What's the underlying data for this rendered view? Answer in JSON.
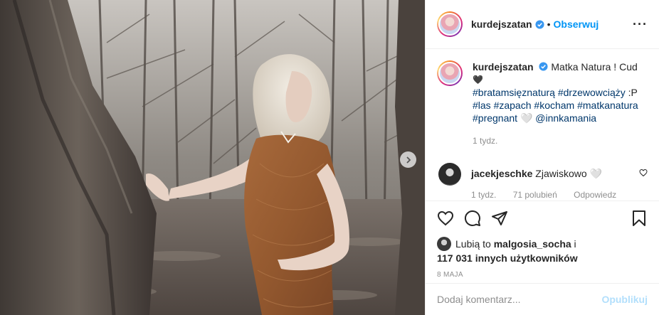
{
  "post": {
    "username": "kurdejszatan",
    "follow_label": "Obserwuj",
    "dot": "•",
    "more_label": "···",
    "caption": {
      "text_start": "Matka Natura ! Cud",
      "emoji": "🖤",
      "tags_line1": [
        "#bratamsięznaturą",
        "#drzewowciąży"
      ],
      "tags_line1_tail": " :P",
      "tags_line2": [
        "#las",
        "#zapach",
        "#kocham",
        "#matkanatura"
      ],
      "tags_line3": [
        "#pregnant"
      ],
      "tags_line3_emoji": "🤍",
      "mention": "@innkamania",
      "age": "1 tydz."
    },
    "comments": [
      {
        "username": "jacekjeschke",
        "text": "Zjawiskowo",
        "emoji": "🤍",
        "age": "1 tydz.",
        "likes": "71 polubień",
        "reply_label": "Odpowiedz"
      }
    ],
    "likes": {
      "prefix": "Lubią to",
      "user": "malgosia_socha",
      "conj": "i",
      "others": "117 031 innych użytkowników"
    },
    "date": "8 MAJA",
    "comment_input": {
      "placeholder": "Dodaj komentarz...",
      "publish_label": "Opublikuj"
    }
  },
  "colors": {
    "accent": "#0095f6",
    "publish_disabled": "#b2dffc",
    "muted": "#8e8e8e",
    "tag": "#00376b"
  },
  "icons": [
    "verified-badge-icon",
    "more-options-icon",
    "heart-icon",
    "comment-icon",
    "share-icon",
    "bookmark-icon",
    "chevron-right-icon"
  ]
}
